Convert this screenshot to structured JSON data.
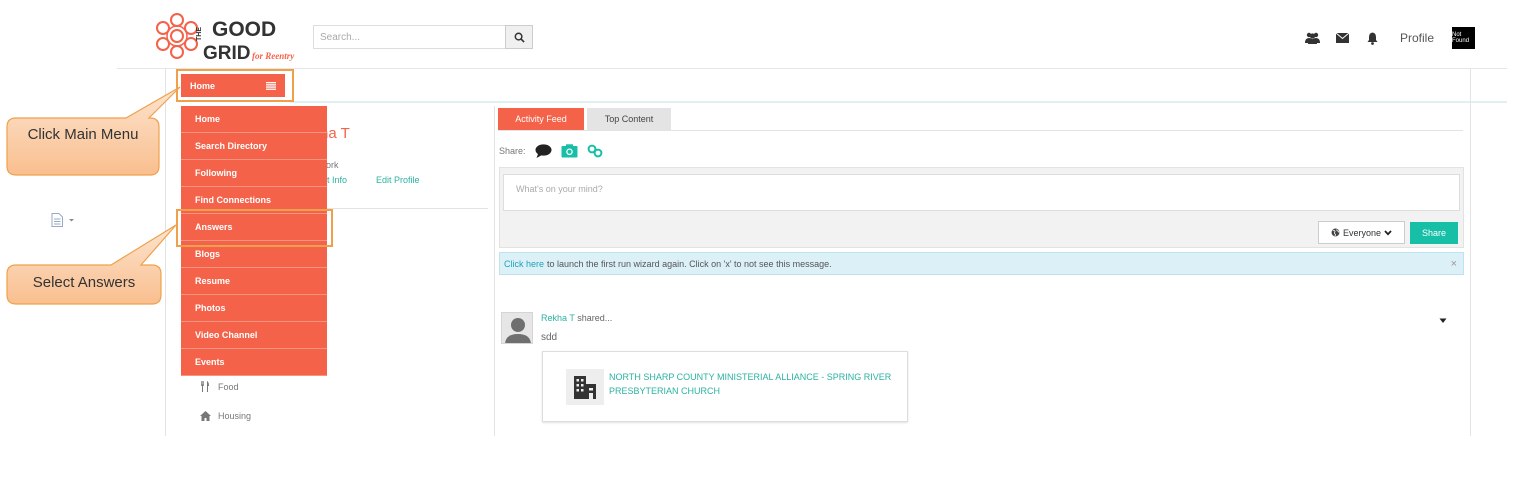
{
  "header": {
    "logo": {
      "line1": "THE",
      "line2": "GOOD",
      "line3": "GRID",
      "tagline": "for Reentry"
    },
    "search": {
      "placeholder": "Search..."
    },
    "profile_label": "Profile",
    "badge_text": "Not Found"
  },
  "nav": {
    "home_button_label": "Home",
    "menu_items": [
      "Home",
      "Search Directory",
      "Following",
      "Find Connections",
      "Answers",
      "Blogs",
      "Resume",
      "Photos",
      "Video Channel",
      "Events"
    ]
  },
  "left_panel": {
    "name_partial": "ha T",
    "work_partial": "ork",
    "info_link_partial": "t Info",
    "edit_profile": "Edit Profile",
    "items": [
      {
        "label": "Food",
        "icon": "utensils-icon"
      },
      {
        "label": "Housing",
        "icon": "home-icon"
      }
    ]
  },
  "annotations": {
    "click_main_menu": "Click Main Menu",
    "select_answers": "Select Answers",
    "highlight_color": "#f0a04b"
  },
  "feed": {
    "tabs": [
      "Activity Feed",
      "Top Content"
    ],
    "share_label": "Share:",
    "composer_placeholder": "What's on your mind?",
    "audience_label": "Everyone",
    "share_button": "Share",
    "alert": {
      "link_text": "Click here",
      "message": "to launch the first run wizard again. Click on 'x' to not see this message.",
      "close": "×"
    },
    "post": {
      "author": "Rekha T",
      "action": "shared...",
      "body": "sdd",
      "card_title": "NORTH SHARP COUNTY MINISTERIAL ALLIANCE - SPRING RIVER PRESBYTERIAN CHURCH"
    }
  },
  "colors": {
    "brand_orange": "#f4624a",
    "teal": "#17bfa7",
    "link_teal": "#2bb3a0"
  }
}
